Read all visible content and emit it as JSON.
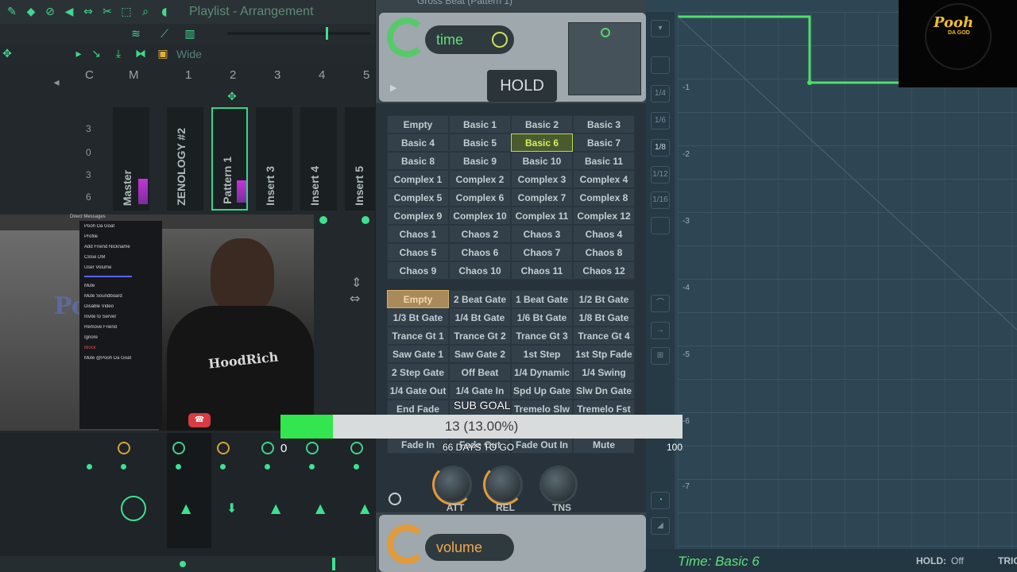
{
  "mixer": {
    "playlist_label": "Playlist - Arrangement",
    "wide_label": "Wide",
    "columns": [
      "C",
      "M",
      "1",
      "2",
      "3",
      "4",
      "5"
    ],
    "db_marks": [
      "3",
      "0",
      "3",
      "6"
    ],
    "tracks": [
      "Master",
      "ZENOLOGY #2",
      "Pattern 1",
      "Insert 3",
      "Insert 4",
      "Insert 5"
    ]
  },
  "webcam": {
    "dm_header": "Direct Messages",
    "menu_items": [
      "Pooh Da Goat",
      "Profile",
      "Add Friend Nickname",
      "Close DM",
      "User Volume",
      "Mute",
      "Mute Soundboard",
      "Disable Video",
      "Invite to Server",
      "Remove Friend",
      "Ignore",
      "Block",
      "Mute @Pooh Da Goat"
    ],
    "shirt_text": "HoodRich",
    "watermark": "Pooh"
  },
  "grossbeat": {
    "title": "Gross Beat (Pattern 1)",
    "time_label": "time",
    "hold_label": "HOLD",
    "time_presets": [
      "Empty",
      "Basic 1",
      "Basic 2",
      "Basic 3",
      "Basic 4",
      "Basic 5",
      "Basic 6",
      "Basic 7",
      "Basic 8",
      "Basic 9",
      "Basic 10",
      "Basic 11",
      "Complex 1",
      "Complex 2",
      "Complex 3",
      "Complex 4",
      "Complex 5",
      "Complex 6",
      "Complex 7",
      "Complex 8",
      "Complex 9",
      "Complex 10",
      "Complex 11",
      "Complex 12",
      "Chaos 1",
      "Chaos 2",
      "Chaos 3",
      "Chaos 4",
      "Chaos 5",
      "Chaos 6",
      "Chaos 7",
      "Chaos 8",
      "Chaos 9",
      "Chaos 10",
      "Chaos 11",
      "Chaos 12"
    ],
    "selected_time_preset": "Basic 6",
    "volume_presets": [
      "Empty",
      "2 Beat Gate",
      "1 Beat Gate",
      "1/2 Bt Gate",
      "1/3 Bt Gate",
      "1/4 Bt Gate",
      "1/6 Bt Gate",
      "1/8 Bt Gate",
      "Trance Gt 1",
      "Trance Gt 2",
      "Trance Gt 3",
      "Trance Gt 4",
      "Saw Gate 1",
      "Saw Gate 2",
      "1st Step",
      "1st Stp Fade",
      "2 Step Gate",
      "Off Beat",
      "1/4 Dynamic",
      "1/4 Swing",
      "1/4 Gate Out",
      "1/4 Gate In",
      "Spd Up Gate",
      "Slw Dn Gate",
      "End Fade",
      "",
      "Tremelo Slw",
      "Tremelo Fst"
    ],
    "volume_presets_lower": [
      "Fade In",
      "Fade Out",
      "Fade Out In",
      "Mute"
    ],
    "selected_volume_preset": "Empty",
    "knobs": [
      "ATT",
      "REL",
      "TNS"
    ],
    "volume_label": "volume"
  },
  "envelope": {
    "y_marks": [
      "-1",
      "-2",
      "-3",
      "-4",
      "-5",
      "-6",
      "-7"
    ],
    "side_buttons": [
      "",
      "",
      "1/4",
      "1/6",
      "1/8",
      "1/12",
      "1/16",
      "",
      "",
      ""
    ],
    "status_time": "Time: Basic 6",
    "hold_label": "HOLD:",
    "hold_value": "Off",
    "trig_label": "TRIG"
  },
  "logo": {
    "text": "Pooh",
    "sub": "DA GOD"
  },
  "subgoal": {
    "title": "SUB GOAL",
    "progress_text": "13 (13.00%)",
    "progress_fraction": 0.13,
    "min": "0",
    "max": "100",
    "days_left": "66 DAYS TO GO"
  },
  "colors": {
    "accent_green": "#3fe08f",
    "progress_green": "#33e54e",
    "time_green": "#5fe07a",
    "volume_orange": "#e29a3a"
  }
}
